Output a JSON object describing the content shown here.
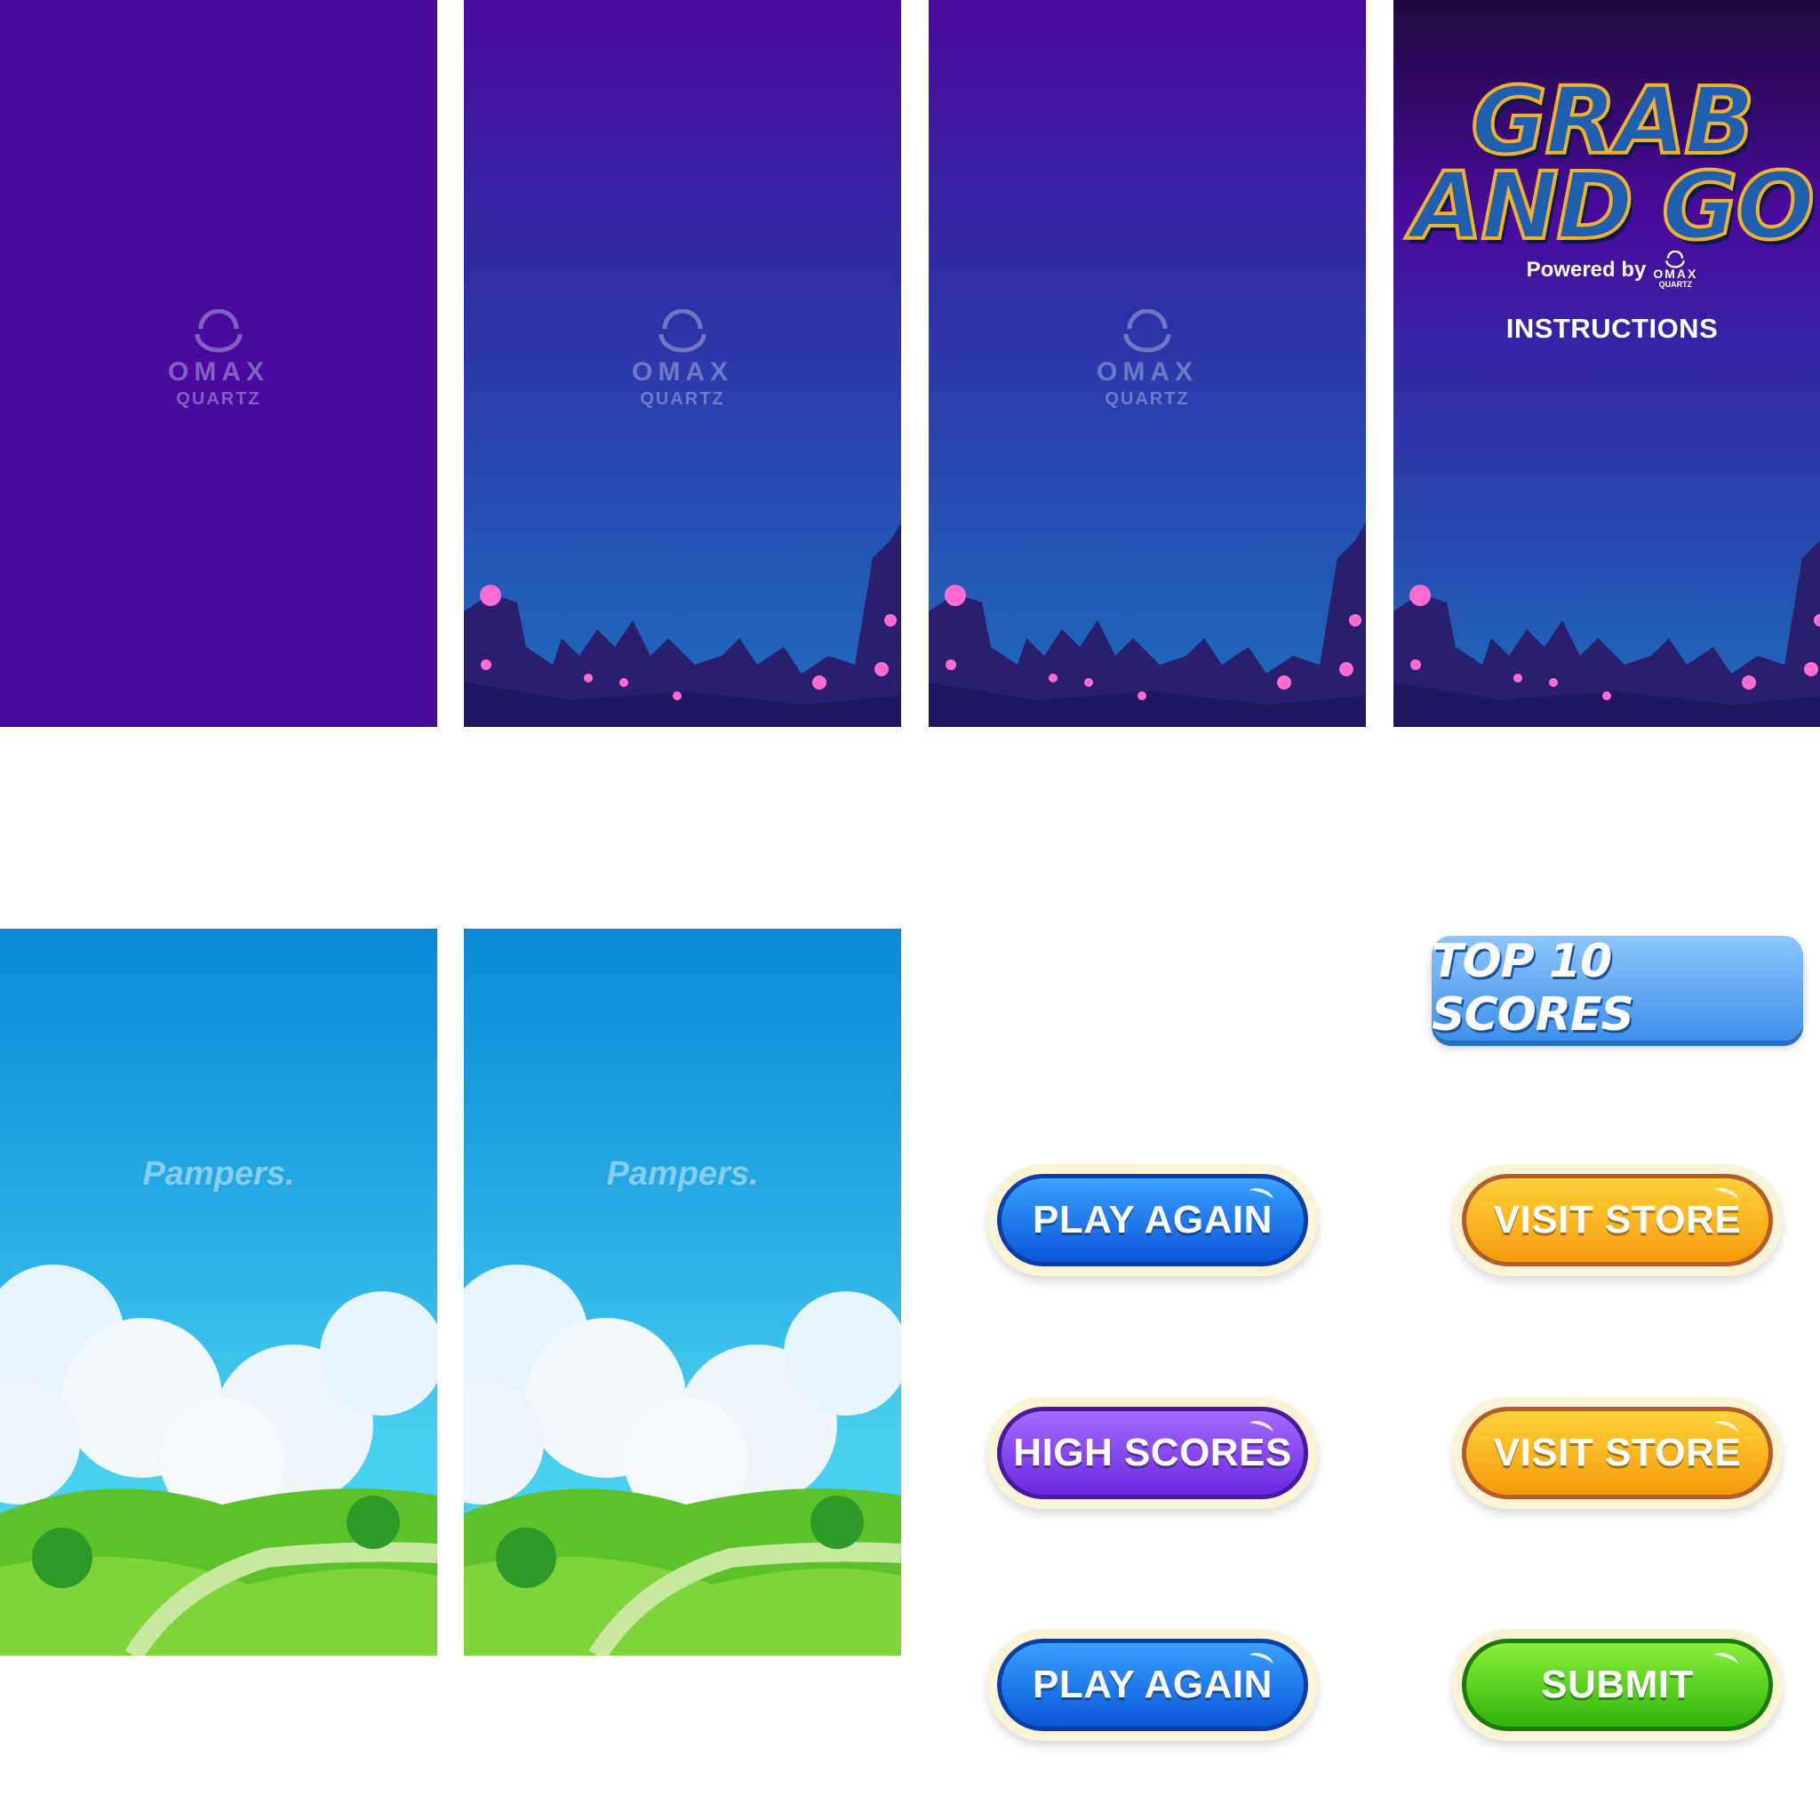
{
  "splash": {
    "brand": "OMAX",
    "sub": "QUARTZ"
  },
  "title_screen": {
    "title_line1": "GRAB",
    "title_line2": "AND GO",
    "powered_by": "Powered by",
    "powered_brand": "OMAX",
    "powered_sub": "QUARTZ",
    "instructions": "INSTRUCTIONS"
  },
  "pampers_screen": {
    "brand": "Pampers."
  },
  "buttons": {
    "top_scores": "TOP 10 SCORES",
    "play_again_1": "PLAY AGAIN",
    "visit_store_1": "VISIT STORE",
    "high_scores": "HIGH SCORES",
    "visit_store_2": "VISIT STORE",
    "play_again_2": "PLAY AGAIN",
    "submit": "SUBMIT"
  },
  "colors": {
    "purple_bg": "#4a0a9e",
    "night_top": "#4a0a9e",
    "night_bottom": "#1d6fbd",
    "sky_top": "#0a8ad6",
    "sky_bottom": "#48d0f0",
    "grass": "#5cc22a"
  }
}
